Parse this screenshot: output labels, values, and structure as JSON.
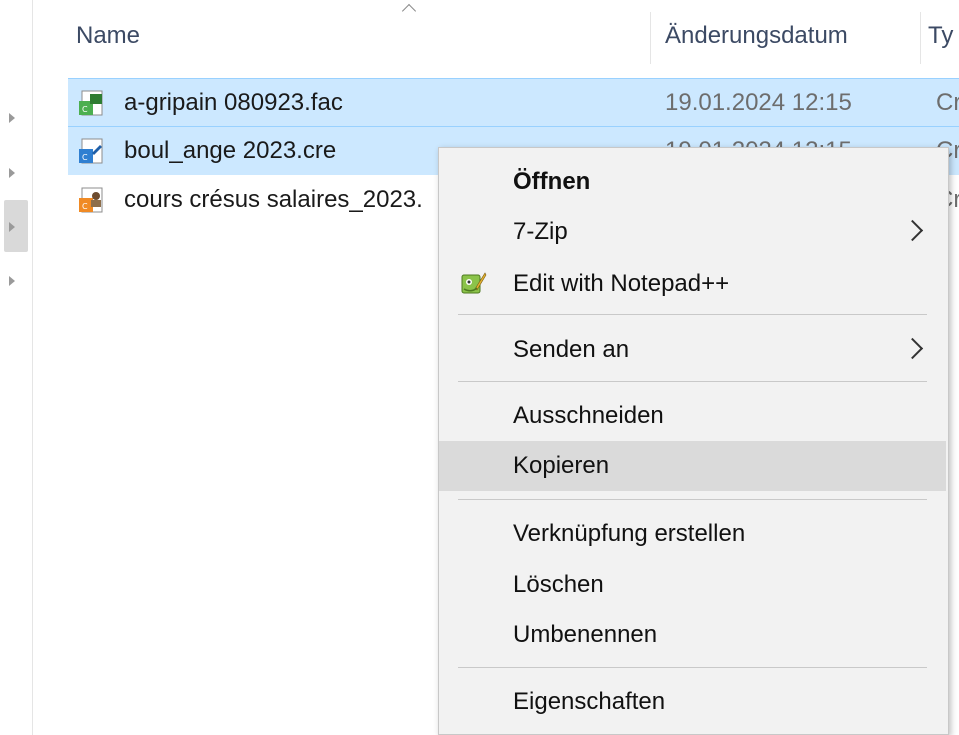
{
  "header": {
    "name": "Name",
    "date": "Änderungsdatum",
    "type": "Ty"
  },
  "files": [
    {
      "name": "a-gripain 080923.fac",
      "date": "19.01.2024 12:15",
      "type": "Cr",
      "icon": "cresus-invoice-icon",
      "selected": true
    },
    {
      "name": "boul_ange 2023.cre",
      "date": "19.01.2024 12:15",
      "type": "Cr",
      "icon": "cresus-accounting-icon",
      "selected": true
    },
    {
      "name": "cours crésus salaires_2023.",
      "date": "",
      "type": "Cr",
      "icon": "cresus-salary-icon",
      "selected": false
    }
  ],
  "context_menu": {
    "items": [
      {
        "label": "Öffnen",
        "bold": true
      },
      {
        "label": "7-Zip",
        "submenu": true
      },
      {
        "label": "Edit with Notepad++",
        "icon": "notepadpp-icon"
      },
      {
        "label": "Senden an",
        "submenu": true
      },
      {
        "label": "Ausschneiden"
      },
      {
        "label": "Kopieren",
        "hovered": true
      },
      {
        "label": "Verknüpfung erstellen"
      },
      {
        "label": "Löschen"
      },
      {
        "label": "Umbenennen"
      },
      {
        "label": "Eigenschaften"
      }
    ]
  },
  "colors": {
    "selection": "#cce8ff",
    "menu_bg": "#f2f2f2",
    "menu_hover": "#dadada",
    "header_text": "#3c4a64"
  }
}
